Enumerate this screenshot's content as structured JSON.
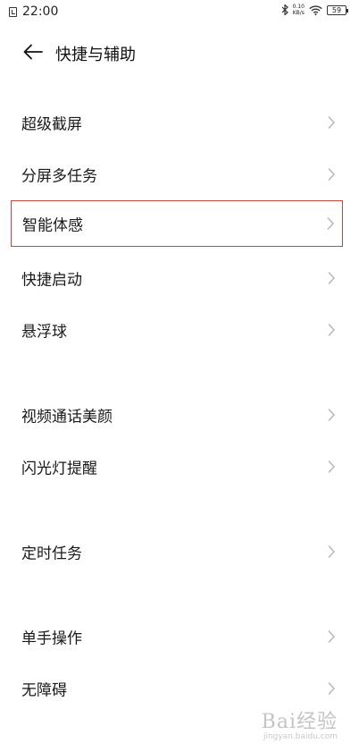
{
  "status_bar": {
    "time": "22:00",
    "net_speed_value": "0.10",
    "net_speed_unit": "KB/s",
    "battery": "59"
  },
  "header": {
    "title": "快捷与辅助"
  },
  "items": [
    {
      "label": "超级截屏"
    },
    {
      "label": "分屏多任务"
    },
    {
      "label": "智能体感"
    },
    {
      "label": "快捷启动"
    },
    {
      "label": "悬浮球"
    },
    {
      "label": "视频通话美颜"
    },
    {
      "label": "闪光灯提醒"
    },
    {
      "label": "定时任务"
    },
    {
      "label": "单手操作"
    },
    {
      "label": "无障碍"
    }
  ],
  "watermark": {
    "logo": "Bai经验",
    "url": "jingyan.baidu.com"
  },
  "colors": {
    "highlight_border": "#c8463a",
    "chevron": "#b5b5b5"
  }
}
